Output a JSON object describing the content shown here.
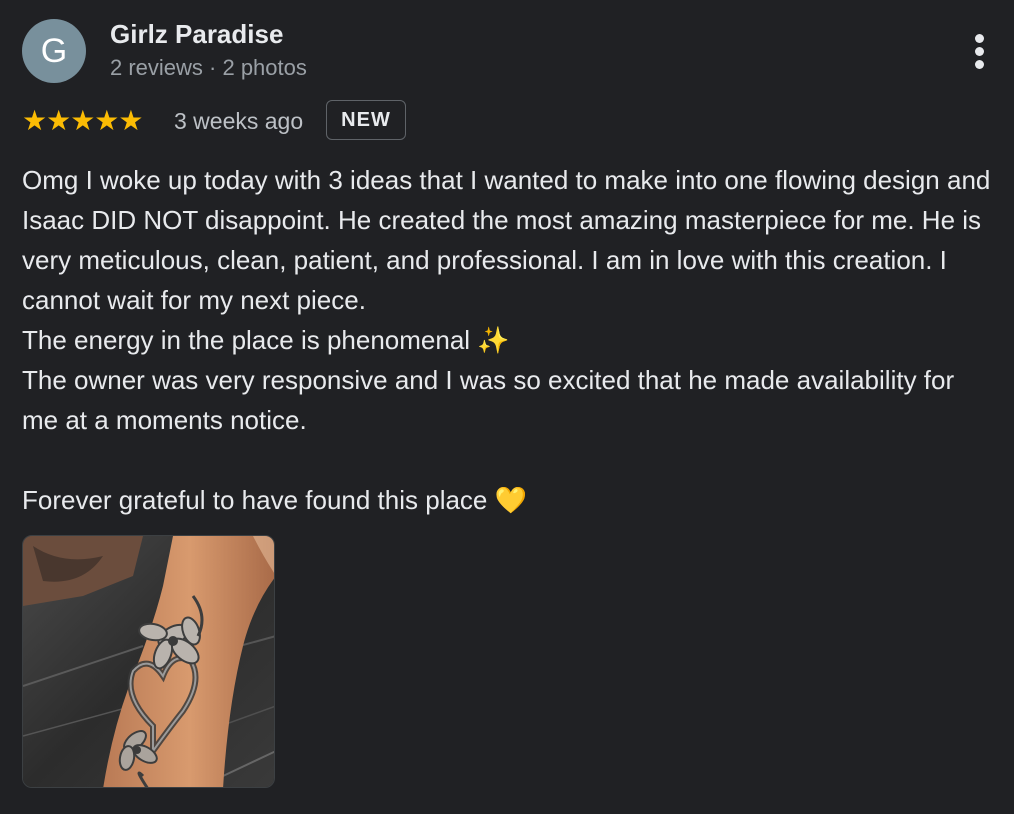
{
  "author": {
    "avatar_letter": "G",
    "avatar_color": "#78909c",
    "name": "Girlz Paradise",
    "meta": "2 reviews · 2 photos"
  },
  "more_menu_icon": "more-vert-icon",
  "rating": {
    "stars": 5,
    "stars_text": "★★★★★",
    "star_color": "#fbbc04",
    "time_ago": "3 weeks ago",
    "badge": "NEW"
  },
  "review": {
    "lines": [
      "Omg I woke up today with 3 ideas that I wanted to make into one flowing design and Isaac DID NOT disappoint. He created the most amazing masterpiece for me. He is very meticulous, clean, patient, and professional. I am in love with this creation. I cannot wait for my next piece.",
      "The energy in the place is phenomenal ✨",
      "The owner was very responsive and I was so excited that he made availability for me at a moments notice.",
      "",
      "Forever grateful to have found this place 💛"
    ]
  },
  "photo": {
    "icon": "review-photo-thumbnail"
  }
}
